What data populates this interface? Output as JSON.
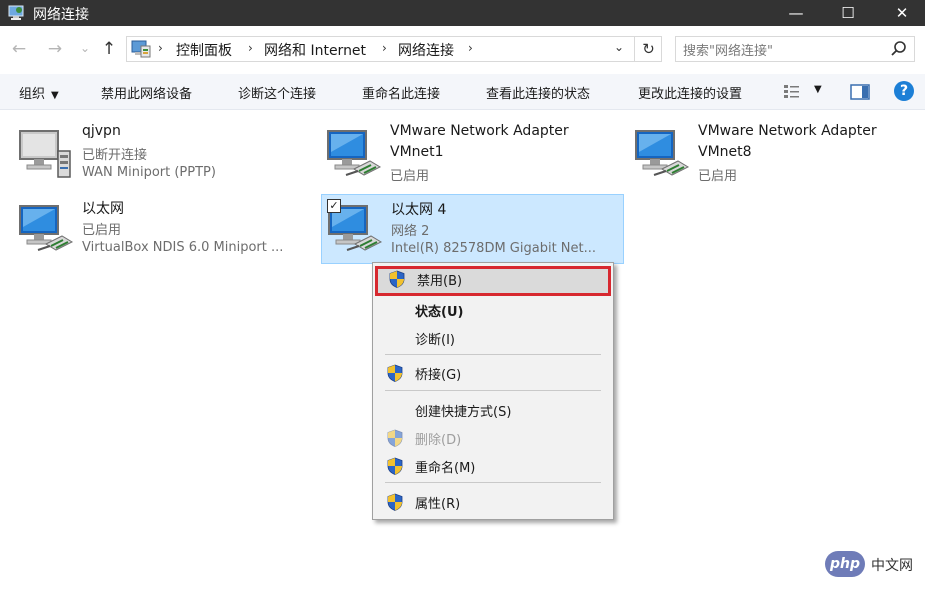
{
  "window": {
    "title": "网络连接"
  },
  "window_buttons": {
    "minimize": "—",
    "maximize": "☐",
    "close": "✕"
  },
  "nav": {
    "back": "←",
    "forward": "→",
    "history": "⌄",
    "up": "↑"
  },
  "address": {
    "crumbs": [
      "控制面板",
      "网络和 Internet",
      "网络连接"
    ],
    "separator": "›",
    "dropdown": "⌄",
    "refresh": "↻"
  },
  "search": {
    "placeholder": "搜索\"网络连接\""
  },
  "toolbar": {
    "organize": "组织",
    "disable_device": "禁用此网络设备",
    "diagnose": "诊断这个连接",
    "rename": "重命名此连接",
    "view_status": "查看此连接的状态",
    "change_settings": "更改此连接的设置",
    "view_caret": "▼",
    "help": "?"
  },
  "connections": [
    {
      "name": "qjvpn",
      "status": "已断开连接",
      "device": "WAN Miniport (PPTP)",
      "icon": "vpn-connection-icon"
    },
    {
      "name": "VMware Network Adapter",
      "status": "VMnet1",
      "device": "已启用",
      "icon": "ethernet-adapter-icon"
    },
    {
      "name": "VMware Network Adapter",
      "status": "VMnet8",
      "device": "已启用",
      "icon": "ethernet-adapter-icon"
    },
    {
      "name": "以太网",
      "status": "已启用",
      "device": "VirtualBox NDIS 6.0 Miniport ...",
      "icon": "ethernet-adapter-icon"
    },
    {
      "name": "以太网 4",
      "status": "网络  2",
      "device": "Intel(R) 82578DM Gigabit Net...",
      "icon": "ethernet-adapter-icon",
      "selected": true,
      "checkbox": "✓"
    }
  ],
  "context_menu": {
    "items": [
      {
        "label": "禁用(B)",
        "shield": true
      },
      {
        "label": "状态(U)",
        "bold": true
      },
      {
        "label": "诊断(I)"
      },
      {
        "label": "桥接(G)",
        "shield": true
      },
      {
        "label": "创建快捷方式(S)"
      },
      {
        "label": "删除(D)",
        "shield": true,
        "disabled": true
      },
      {
        "label": "重命名(M)",
        "shield": true
      },
      {
        "label": "属性(R)",
        "shield": true
      }
    ]
  },
  "watermark": {
    "logo": "php",
    "text": "中文网"
  },
  "colors": {
    "titlebar": "#333333",
    "selection": "#cce8ff",
    "highlight_border": "#d7282f",
    "help_icon": "#1c7fd6",
    "shield_blue": "#2b65c6",
    "shield_yellow": "#f2c12e"
  }
}
